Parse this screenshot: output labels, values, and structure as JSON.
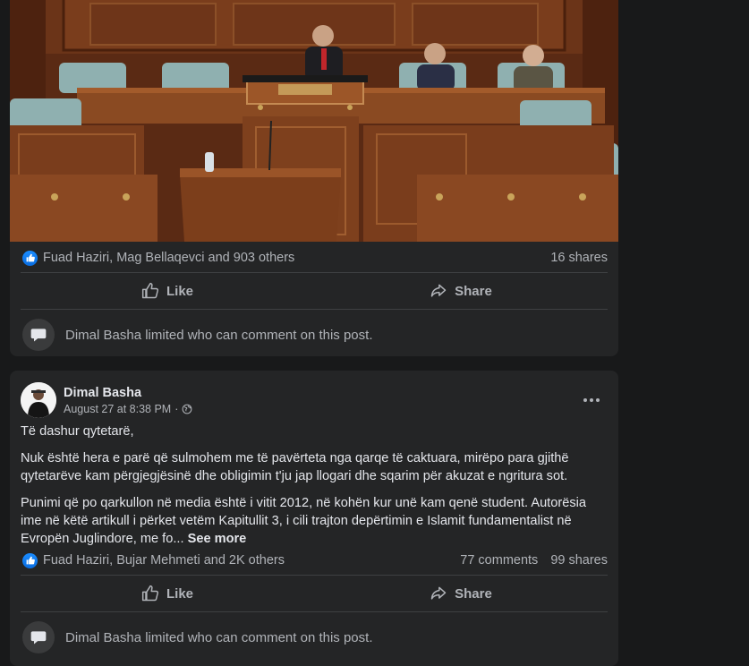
{
  "post1": {
    "reactions_text": "Fuad Haziri, Mag Bellaqevci and 903 others",
    "shares": "16 shares",
    "like_label": "Like",
    "share_label": "Share",
    "comment_notice": "Dimal Basha limited who can comment on this post."
  },
  "post2": {
    "author": "Dimal Basha",
    "timestamp": "August 27 at 8:38 PM",
    "separator": "·",
    "greeting": "Të dashur qytetarë,",
    "paragraph1": "Nuk është hera e parë që sulmohem me të pavërteta nga qarqe të caktuara, mirëpo para gjithë qytetarëve kam përgjegjësinë dhe obligimin t'ju jap llogari dhe sqarim për akuzat e ngritura sot.",
    "paragraph2": "Punimi që po qarkullon në media është i vitit 2012, në kohën kur unë kam qenë student. Autorësia ime në këtë artikull i përket vetëm Kapitullit 3, i cili trajton depërtimin e Islamit fundamentalist në Evropën Juglindore, me fo...",
    "see_more": "See more",
    "reactions_text": "Fuad Haziri, Bujar Mehmeti and 2K others",
    "comments": "77 comments",
    "shares": "99 shares",
    "like_label": "Like",
    "share_label": "Share",
    "comment_notice": "Dimal Basha limited who can comment on this post."
  },
  "icons": {
    "like_badge": "like-badge-icon",
    "thumb": "thumbs-up-icon",
    "share": "share-arrow-icon",
    "comment_bubble": "comment-bubble-icon",
    "globe": "globe-icon",
    "more": "more-options-icon"
  },
  "colors": {
    "background": "#18191a",
    "card": "#242526",
    "text_primary": "#e4e6eb",
    "text_secondary": "#b0b3b8",
    "like_blue": "#1877f2",
    "divider": "#3e4042"
  }
}
